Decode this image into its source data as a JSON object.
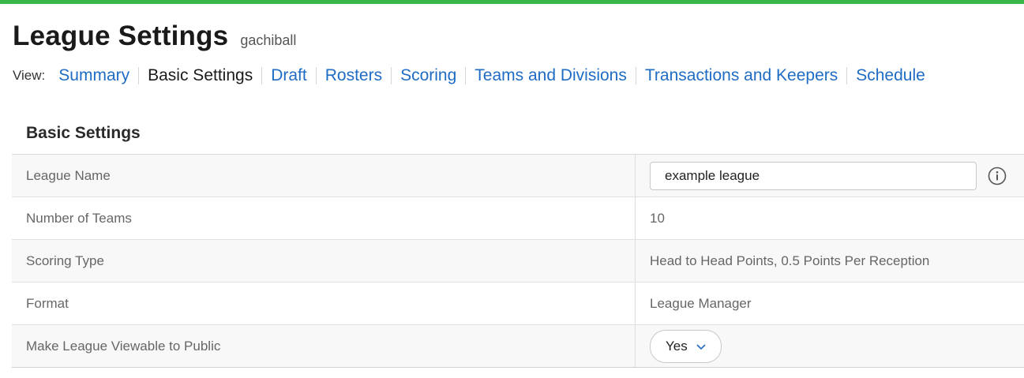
{
  "header": {
    "title": "League Settings",
    "league_name": "gachiball"
  },
  "view_nav": {
    "label": "View:",
    "items": [
      {
        "label": "Summary",
        "active": false
      },
      {
        "label": "Basic Settings",
        "active": true
      },
      {
        "label": "Draft",
        "active": false
      },
      {
        "label": "Rosters",
        "active": false
      },
      {
        "label": "Scoring",
        "active": false
      },
      {
        "label": "Teams and Divisions",
        "active": false
      },
      {
        "label": "Transactions and Keepers",
        "active": false
      },
      {
        "label": "Schedule",
        "active": false
      }
    ]
  },
  "section": {
    "title": "Basic Settings",
    "rows": [
      {
        "label": "League Name",
        "value": "example league"
      },
      {
        "label": "Number of Teams",
        "value": "10"
      },
      {
        "label": "Scoring Type",
        "value": "Head to Head Points, 0.5 Points Per Reception"
      },
      {
        "label": "Format",
        "value": "League Manager"
      },
      {
        "label": "Make League Viewable to Public",
        "value": "Yes"
      }
    ]
  },
  "colors": {
    "accent_bar": "#3ab54a",
    "link": "#1f6cc4"
  },
  "icons": {
    "info": "info-circle-icon",
    "dropdown": "chevron-down-icon"
  }
}
